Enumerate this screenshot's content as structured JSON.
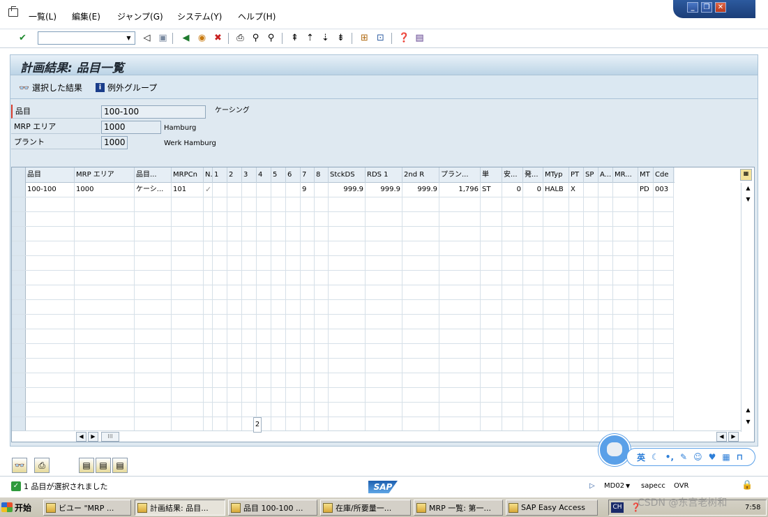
{
  "menu": [
    "一覧(L)",
    "編集(E)",
    "ジャンプ(G)",
    "システム(Y)",
    "ヘルプ(H)"
  ],
  "window_controls": {
    "minimize": "_",
    "restore": "❐",
    "close": "✕"
  },
  "toolbar": {
    "command_value": "",
    "icons": [
      "enter-icon",
      "back-icon",
      "save-icon",
      "back-nav-icon",
      "exit-icon",
      "cancel-icon",
      "print-icon",
      "find-icon",
      "find-next-icon",
      "first-page-icon",
      "prev-page-icon",
      "next-page-icon",
      "last-page-icon",
      "new-session-icon",
      "shortcut-icon",
      "help-icon",
      "layout-icon"
    ]
  },
  "title": "計画結果: 品目一覧",
  "app_toolbar": {
    "selected_results": "選択した結果",
    "exception_groups": "例外グループ"
  },
  "header_fields": {
    "material_label": "品目",
    "material_value": "100-100",
    "material_desc": "ケーシング",
    "mrp_area_label": "MRP エリア",
    "mrp_area_value": "1000",
    "mrp_area_desc": "Hamburg",
    "plant_label": "プラント",
    "plant_value": "1000",
    "plant_desc": "Werk Hamburg"
  },
  "table": {
    "columns": [
      "品目",
      "MRP エリア",
      "品目...",
      "MRPCn",
      "N.",
      "1",
      "2",
      "3",
      "4",
      "5",
      "6",
      "7",
      "8",
      "StckDS",
      "RDS 1",
      "2nd R",
      "プラン...",
      "単",
      "安...",
      "発...",
      "MTyp",
      "PT",
      "SP",
      "A...",
      "MR...",
      "MT",
      "Cde"
    ],
    "rows": [
      [
        "100-100",
        "1000",
        "ケーシ...",
        "101",
        "✓",
        "",
        "",
        "",
        "",
        "",
        "",
        "9",
        "",
        "999.9",
        "999.9",
        "999.9",
        "1,796",
        "ST",
        "0",
        "0",
        "HALB",
        "X",
        "",
        "",
        "",
        "PD",
        "003"
      ]
    ],
    "page_indicator": "2"
  },
  "status": {
    "message": "1 品目が選択されました",
    "transaction": "MD02",
    "server": "sapecc",
    "mode": "OVR"
  },
  "sap_logo": "SAP",
  "ime": {
    "lang": "英"
  },
  "taskbar": {
    "start": "开始",
    "tasks": [
      "ビユー \"MRP ...",
      "計画結果: 品目...",
      "品目 100-100 ...",
      "在庫/所要量一...",
      "MRP 一覧: 第一...",
      "SAP Easy Access"
    ],
    "tray_lang": "CH",
    "clock": "7:58"
  },
  "watermark": "CSDN @东宫老树和"
}
